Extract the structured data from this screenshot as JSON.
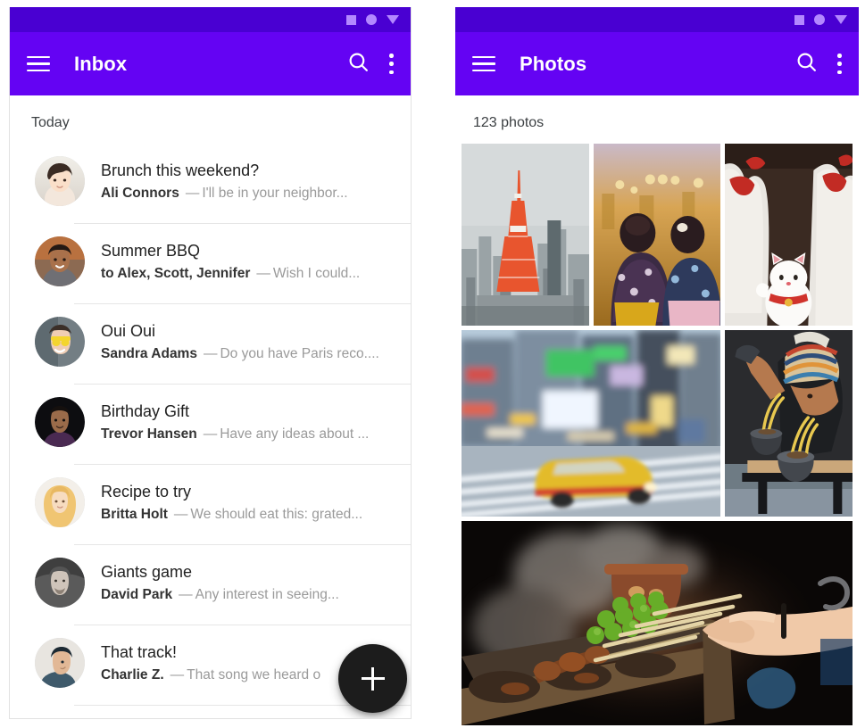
{
  "status_bar": {
    "icons": [
      "square-icon",
      "circle-icon",
      "triangle-down-icon"
    ]
  },
  "colors": {
    "status_bar": "#4900d2",
    "app_bar": "#6403f3",
    "fab": "#1c1c1c",
    "primary_text": "#212121",
    "secondary_text": "#9a9a9a"
  },
  "inbox": {
    "title": "Inbox",
    "menu_icon": "hamburger-menu-icon",
    "search_icon": "search-icon",
    "overflow_icon": "more-vert-icon",
    "section_label": "Today",
    "fab_label": "+",
    "messages": [
      {
        "subject": "Brunch this weekend?",
        "sender": "Ali Connors",
        "dash": "—",
        "snippet": "I'll be in your neighbor..."
      },
      {
        "subject": "Summer BBQ",
        "sender": "to Alex, Scott, Jennifer",
        "dash": "—",
        "snippet": "Wish I could..."
      },
      {
        "subject": "Oui Oui",
        "sender": "Sandra Adams",
        "dash": "—",
        "snippet": "Do you have Paris reco...."
      },
      {
        "subject": "Birthday Gift",
        "sender": "Trevor Hansen",
        "dash": "—",
        "snippet": "Have any ideas about ..."
      },
      {
        "subject": "Recipe to try",
        "sender": "Britta Holt",
        "dash": "—",
        "snippet": "We should eat this: grated..."
      },
      {
        "subject": "Giants game",
        "sender": "David Park",
        "dash": "—",
        "snippet": "Any interest in seeing..."
      },
      {
        "subject": "That track!",
        "sender": "Charlie Z.",
        "dash": "—",
        "snippet": "That song we heard o"
      }
    ]
  },
  "photos": {
    "title": "Photos",
    "menu_icon": "hamburger-menu-icon",
    "search_icon": "search-icon",
    "overflow_icon": "more-vert-icon",
    "count_label": "123 photos",
    "tiles": [
      {
        "name": "photo-tokyo-tower-cityscape"
      },
      {
        "name": "photo-festival-yukata-crowd"
      },
      {
        "name": "photo-maneki-neko-cat-statues"
      },
      {
        "name": "photo-motion-blur-taxi-street"
      },
      {
        "name": "photo-man-eating-ramen"
      },
      {
        "name": "photo-yakitori-grill-skewers"
      }
    ]
  }
}
